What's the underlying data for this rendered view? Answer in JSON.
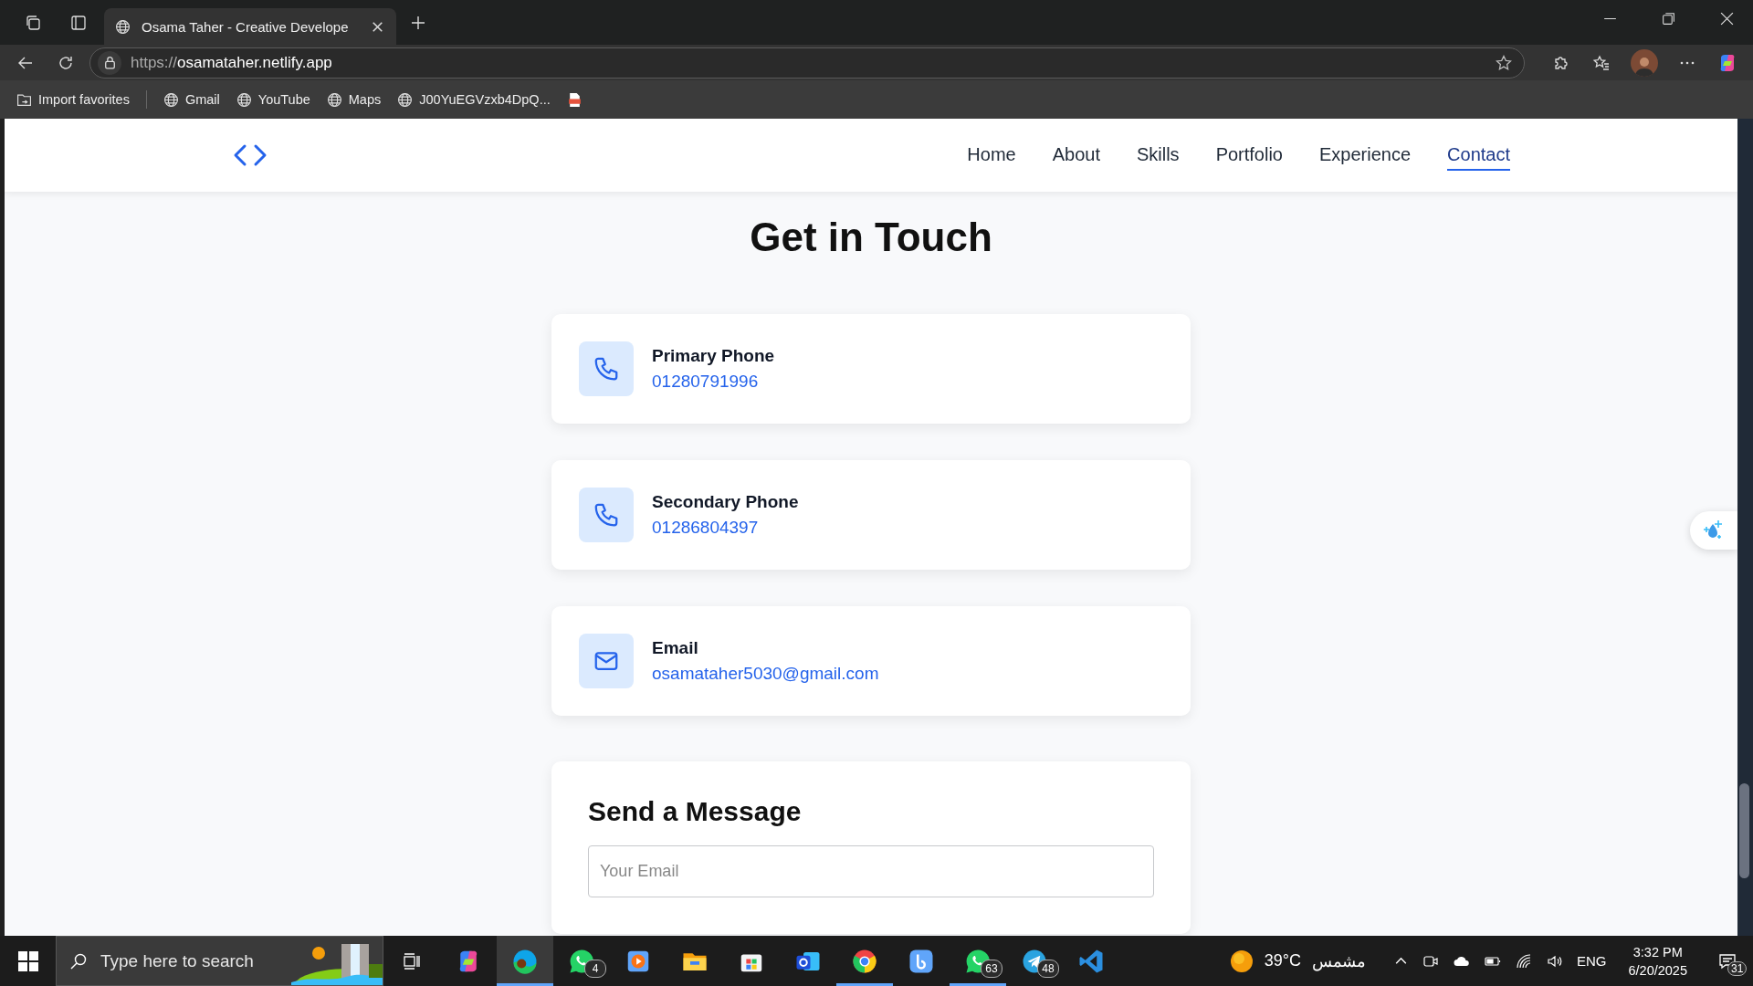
{
  "browser": {
    "tab": {
      "title": "Osama Taher - Creative Develope"
    },
    "address": {
      "scheme": "https://",
      "host": "osamataher.netlify.app"
    },
    "bookmarks": [
      {
        "kind": "import",
        "label": "Import favorites"
      },
      {
        "kind": "site",
        "label": "Gmail"
      },
      {
        "kind": "site",
        "label": "YouTube"
      },
      {
        "kind": "site",
        "label": "Maps"
      },
      {
        "kind": "site",
        "label": "J00YuEGVzxb4DpQ..."
      },
      {
        "kind": "pdf"
      }
    ]
  },
  "page": {
    "nav": {
      "links": [
        {
          "label": "Home",
          "selected": false
        },
        {
          "label": "About",
          "selected": false
        },
        {
          "label": "Skills",
          "selected": false
        },
        {
          "label": "Portfolio",
          "selected": false
        },
        {
          "label": "Experience",
          "selected": false
        },
        {
          "label": "Contact",
          "selected": true
        }
      ]
    },
    "heading": "Get in Touch",
    "contacts": [
      {
        "kind": "phone",
        "label": "Primary Phone",
        "value": "01280791996"
      },
      {
        "kind": "phone",
        "label": "Secondary Phone",
        "value": "01286804397"
      },
      {
        "kind": "email",
        "label": "Email",
        "value": "osamataher5030@gmail.com"
      }
    ],
    "form": {
      "title": "Send a Message",
      "email": {
        "placeholder": "Your Email"
      }
    }
  },
  "taskbar": {
    "search": {
      "placeholder": "Type here to search"
    },
    "apps": [
      {
        "kind": "copilot",
        "selected": false,
        "running": false
      },
      {
        "kind": "edge",
        "selected": true,
        "running": true
      },
      {
        "kind": "whatsapp",
        "badge": "4",
        "selected": false,
        "running": false
      },
      {
        "kind": "media",
        "selected": false,
        "running": false
      },
      {
        "kind": "explorer",
        "selected": false,
        "running": false
      },
      {
        "kind": "store",
        "selected": false,
        "running": false
      },
      {
        "kind": "outlook",
        "selected": false,
        "running": false
      },
      {
        "kind": "chrome",
        "selected": false,
        "running": true
      },
      {
        "kind": "cloudapp",
        "selected": false,
        "running": false
      },
      {
        "kind": "whatsapp",
        "badge": "63",
        "selected": false,
        "running": true
      },
      {
        "kind": "telegram",
        "badge": "48",
        "selected": false,
        "running": false
      },
      {
        "kind": "vscode",
        "selected": false,
        "running": false
      }
    ],
    "weather": {
      "temperature": "39°C",
      "condition": "مشمس"
    },
    "language": "ENG",
    "time": "3:32 PM",
    "date": "6/20/2025",
    "notifications": "31"
  }
}
